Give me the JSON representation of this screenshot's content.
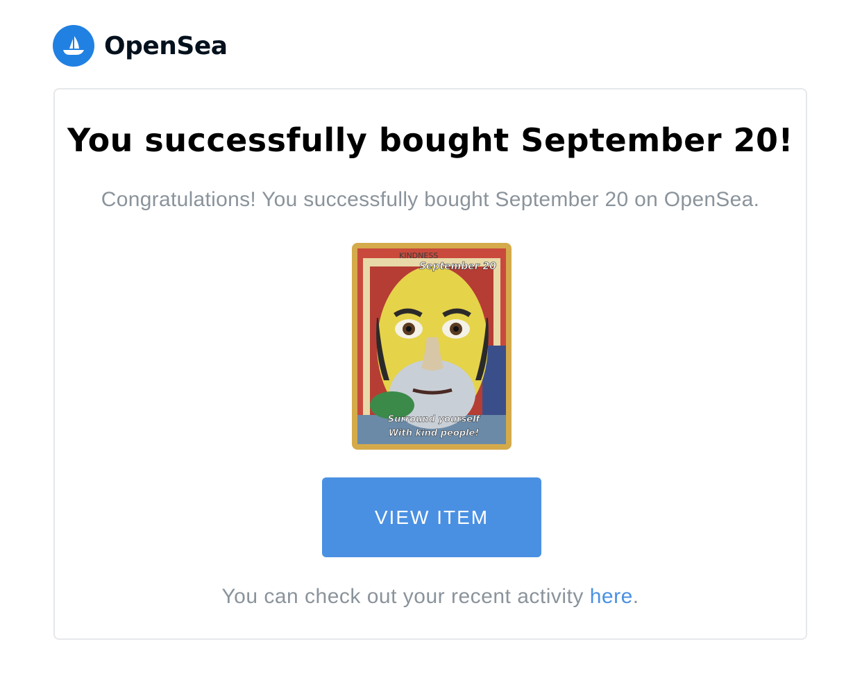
{
  "header": {
    "brand_name": "OpenSea",
    "logo_icon": "opensea-ship-icon",
    "brand_color": "#2081E2"
  },
  "card": {
    "title": "You successfully bought September 20!",
    "subtitle": "Congratulations! You successfully bought September 20 on OpenSea.",
    "nft": {
      "name_on_card": "September 20",
      "top_text": "KINDNESS",
      "caption_line1": "Surround yourself",
      "caption_line2": "With kind people!",
      "frame_color": "#d4aa4a"
    },
    "view_button_label": "VIEW ITEM",
    "button_color": "#4a90e2",
    "footer_prefix": "You can check out your recent activity ",
    "footer_link": "here",
    "footer_suffix": "."
  }
}
